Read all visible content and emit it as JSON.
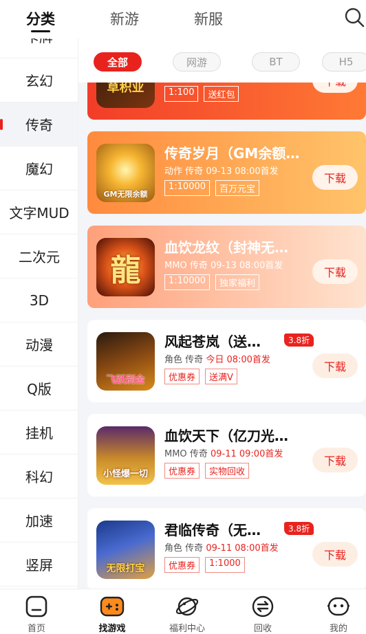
{
  "top_tabs": [
    "分类",
    "新游",
    "新服"
  ],
  "sidebar": {
    "items": [
      {
        "label": "卡牌"
      },
      {
        "label": "玄幻"
      },
      {
        "label": "传奇",
        "active": true
      },
      {
        "label": "魔幻"
      },
      {
        "label": "文字MUD"
      },
      {
        "label": "二次元"
      },
      {
        "label": "3D"
      },
      {
        "label": "动漫"
      },
      {
        "label": "Q版"
      },
      {
        "label": "挂机"
      },
      {
        "label": "科幻"
      },
      {
        "label": "加速"
      },
      {
        "label": "竖屏"
      }
    ]
  },
  "filters": [
    {
      "label": "全部",
      "active": true
    },
    {
      "label": "网游"
    },
    {
      "label": "BT"
    },
    {
      "label": "H5"
    }
  ],
  "cards": [
    {
      "style": "red",
      "thumb_text": "草积业",
      "title": "",
      "category": "",
      "tag": "",
      "date": "",
      "tags": [
        "1:100",
        "送红包"
      ],
      "download": "下载"
    },
    {
      "style": "orange",
      "thumb_text": "GM无限余额",
      "title": "传奇岁月（GM余额…",
      "category": "动作",
      "tag": "传奇",
      "date": "09-13 08:00首发",
      "tags": [
        "1:10000",
        "百万元宝"
      ],
      "download": "下载"
    },
    {
      "style": "peach",
      "thumb_text": "龍",
      "title": "血饮龙纹（封神无…",
      "category": "MMO",
      "tag": "传奇",
      "date": "09-13 08:00首发",
      "tags": [
        "1:10000",
        "独家福利"
      ],
      "download": "下载"
    },
    {
      "style": "white",
      "thumb_text": "飞跃刷金",
      "title": "风起苍岚（送…",
      "category": "角色",
      "tag": "传奇",
      "date": "今日 08:00首发",
      "tags": [
        "优惠券",
        "送满V"
      ],
      "discount": "3.8折",
      "download": "下载"
    },
    {
      "style": "white",
      "thumb_text": "小怪爆一切",
      "title": "血饮天下（亿刀光…",
      "category": "MMO",
      "tag": "传奇",
      "date": "09-11 09:00首发",
      "tags": [
        "优惠券",
        "实物回收"
      ],
      "download": "下载"
    },
    {
      "style": "white",
      "thumb_text": "无限打宝",
      "title": "君临传奇（无…",
      "category": "角色",
      "tag": "传奇",
      "date": "09-11 08:00首发",
      "tags": [
        "优惠券",
        "1:1000"
      ],
      "discount": "3.8折",
      "download": "下载"
    }
  ],
  "bottom_nav": [
    {
      "label": "首页",
      "icon": "home-icon"
    },
    {
      "label": "找游戏",
      "icon": "gamepad-icon",
      "active": true
    },
    {
      "label": "福利中心",
      "icon": "planet-icon"
    },
    {
      "label": "回收",
      "icon": "exchange-icon"
    },
    {
      "label": "我的",
      "icon": "profile-icon"
    }
  ],
  "colors": {
    "accent": "#e8231e",
    "sidebar_active_bg": "#f3f4f8",
    "content_bg": "#f4f5f9"
  }
}
